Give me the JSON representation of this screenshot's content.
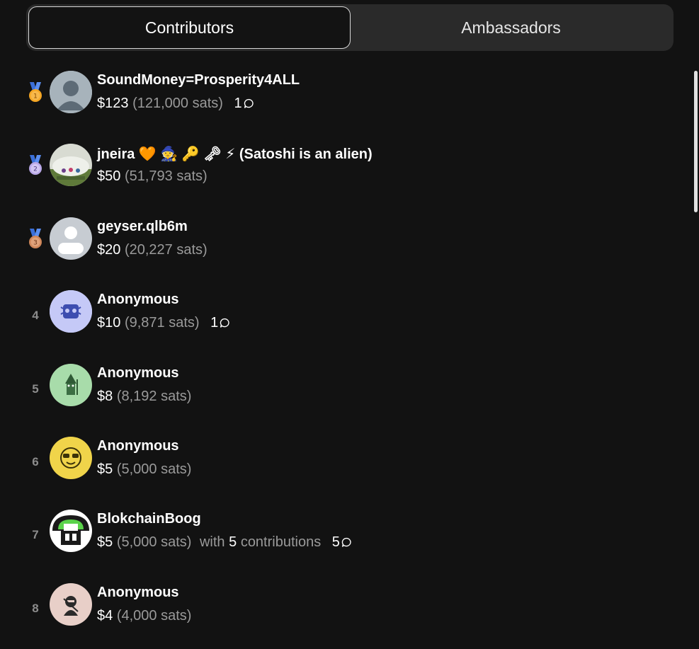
{
  "tabs": [
    {
      "label": "Contributors",
      "active": true
    },
    {
      "label": "Ambassadors",
      "active": false
    }
  ],
  "contributors": [
    {
      "rank": "1",
      "medal": "gold",
      "name": "SoundMoney=Prosperity4ALL",
      "usd": "$123",
      "sats": "(121,000 sats)",
      "comments": "1",
      "avatar": "default-avatar-icon"
    },
    {
      "rank": "2",
      "medal": "silver",
      "name": "jneira 🧡 🧙 🔑 🗝 ⚡ (Satoshi is an alien)",
      "usd": "$50",
      "sats": "(51,793 sats)",
      "comments": null,
      "avatar": "photo-avatar"
    },
    {
      "rank": "3",
      "medal": "bronze",
      "name": "geyser.qlb6m",
      "usd": "$20",
      "sats": "(20,227 sats)",
      "comments": null,
      "avatar": "default-avatar-icon"
    },
    {
      "rank": "4",
      "medal": null,
      "name": "Anonymous",
      "usd": "$10",
      "sats": "(9,871 sats)",
      "comments": "1",
      "avatar": "robot-face-icon"
    },
    {
      "rank": "5",
      "medal": null,
      "name": "Anonymous",
      "usd": "$8",
      "sats": "(8,192 sats)",
      "comments": null,
      "avatar": "wizard-icon"
    },
    {
      "rank": "6",
      "medal": null,
      "name": "Anonymous",
      "usd": "$5",
      "sats": "(5,000 sats)",
      "comments": null,
      "avatar": "sunglasses-face-icon"
    },
    {
      "rank": "7",
      "medal": null,
      "name": "BlokchainBoog",
      "usd": "$5",
      "sats": "(5,000 sats)",
      "with_text": "with",
      "contrib_count": "5",
      "contrib_label": "contributions",
      "comments": "5",
      "avatar": "mushroom-avatar"
    },
    {
      "rank": "8",
      "medal": null,
      "name": "Anonymous",
      "usd": "$4",
      "sats": "(4,000 sats)",
      "comments": null,
      "avatar": "ninja-icon"
    }
  ],
  "colors": {
    "background": "#121212",
    "medal_gold": "#f5a623",
    "medal_silver": "#b9a8e8",
    "medal_bronze": "#d0875a"
  }
}
